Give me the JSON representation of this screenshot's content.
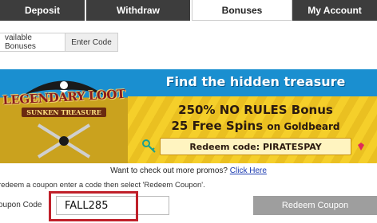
{
  "tabs": [
    {
      "label": "Deposit",
      "active": false
    },
    {
      "label": "Withdraw",
      "active": false
    },
    {
      "label": "Bonuses",
      "active": true
    },
    {
      "label": "My Account",
      "active": false
    }
  ],
  "subtabs": [
    {
      "label": "Available Bonuses",
      "visible_text": "vailable Bonuses"
    },
    {
      "label": "Enter Code",
      "active": true
    }
  ],
  "banner": {
    "logo_line1": "LEGENDARY LOOT",
    "logo_line2": "SUNKEN TREASURE",
    "headline": "Find the hidden treasure",
    "bonus_line1": "250% NO RULES Bonus",
    "bonus_line2_main": "25 Free Spins",
    "bonus_line2_small": "on Goldbeard",
    "redeem_text": "Redeem code: PIRATESPAY",
    "colors": {
      "sky": "#1a8fd0",
      "gold": "#f5cf2a",
      "text_dark": "#2a1a10"
    }
  },
  "promo": {
    "text": "Want to check out more promos? ",
    "link": "Click Here"
  },
  "instructions": "redeem a coupon enter a code then select 'Redeem Coupon'.",
  "coupon": {
    "label": "oupon Code",
    "value": "FALL285",
    "button_label": "Redeem Coupon",
    "highlight_color": "#c0202a"
  }
}
